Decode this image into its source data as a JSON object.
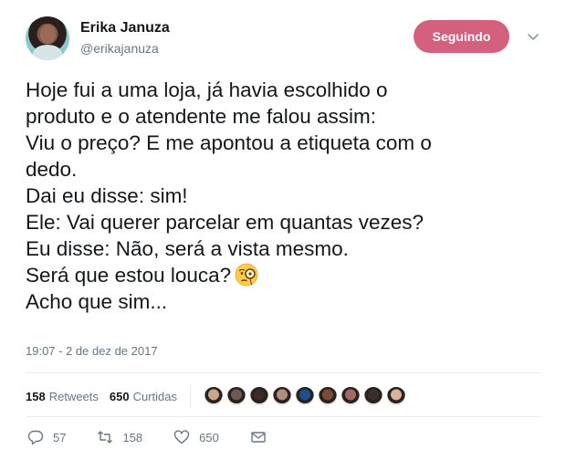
{
  "user": {
    "name": "Erika Januza",
    "handle": "@erikajanuza"
  },
  "follow_button": {
    "label": "Seguindo",
    "color": "#d4607e"
  },
  "tweet": {
    "lines": [
      "Hoje fui a uma loja, já havia escolhido o",
      "produto e o atendente me falou assim:",
      "Viu o preço? E me apontou a etiqueta com o",
      "dedo.",
      "Dai eu disse: sim!",
      "Ele: Vai querer parcelar em quantas vezes?",
      "Eu disse: Não, será a vista mesmo.",
      "Será que estou louca?",
      "Acho que sim..."
    ],
    "emoji": "face-with-monocle-icon",
    "timestamp": "19:07 - 2 de dez de 2017"
  },
  "stats": {
    "retweets_count": "158",
    "retweets_label": "Retweets",
    "likes_count": "650",
    "likes_label": "Curtidas",
    "liker_colors": [
      "#c9a58c",
      "#6b5a50",
      "#3b2a2a",
      "#b08f80",
      "#1d4f8f",
      "#7a4b36",
      "#a06b63",
      "#3a2f2b",
      "#d6b39e"
    ]
  },
  "actions": {
    "replies": "57",
    "retweets": "158",
    "likes": "650"
  },
  "colors": {
    "text": "#14171a",
    "secondary": "#657786",
    "divider": "#e6ecf0"
  }
}
